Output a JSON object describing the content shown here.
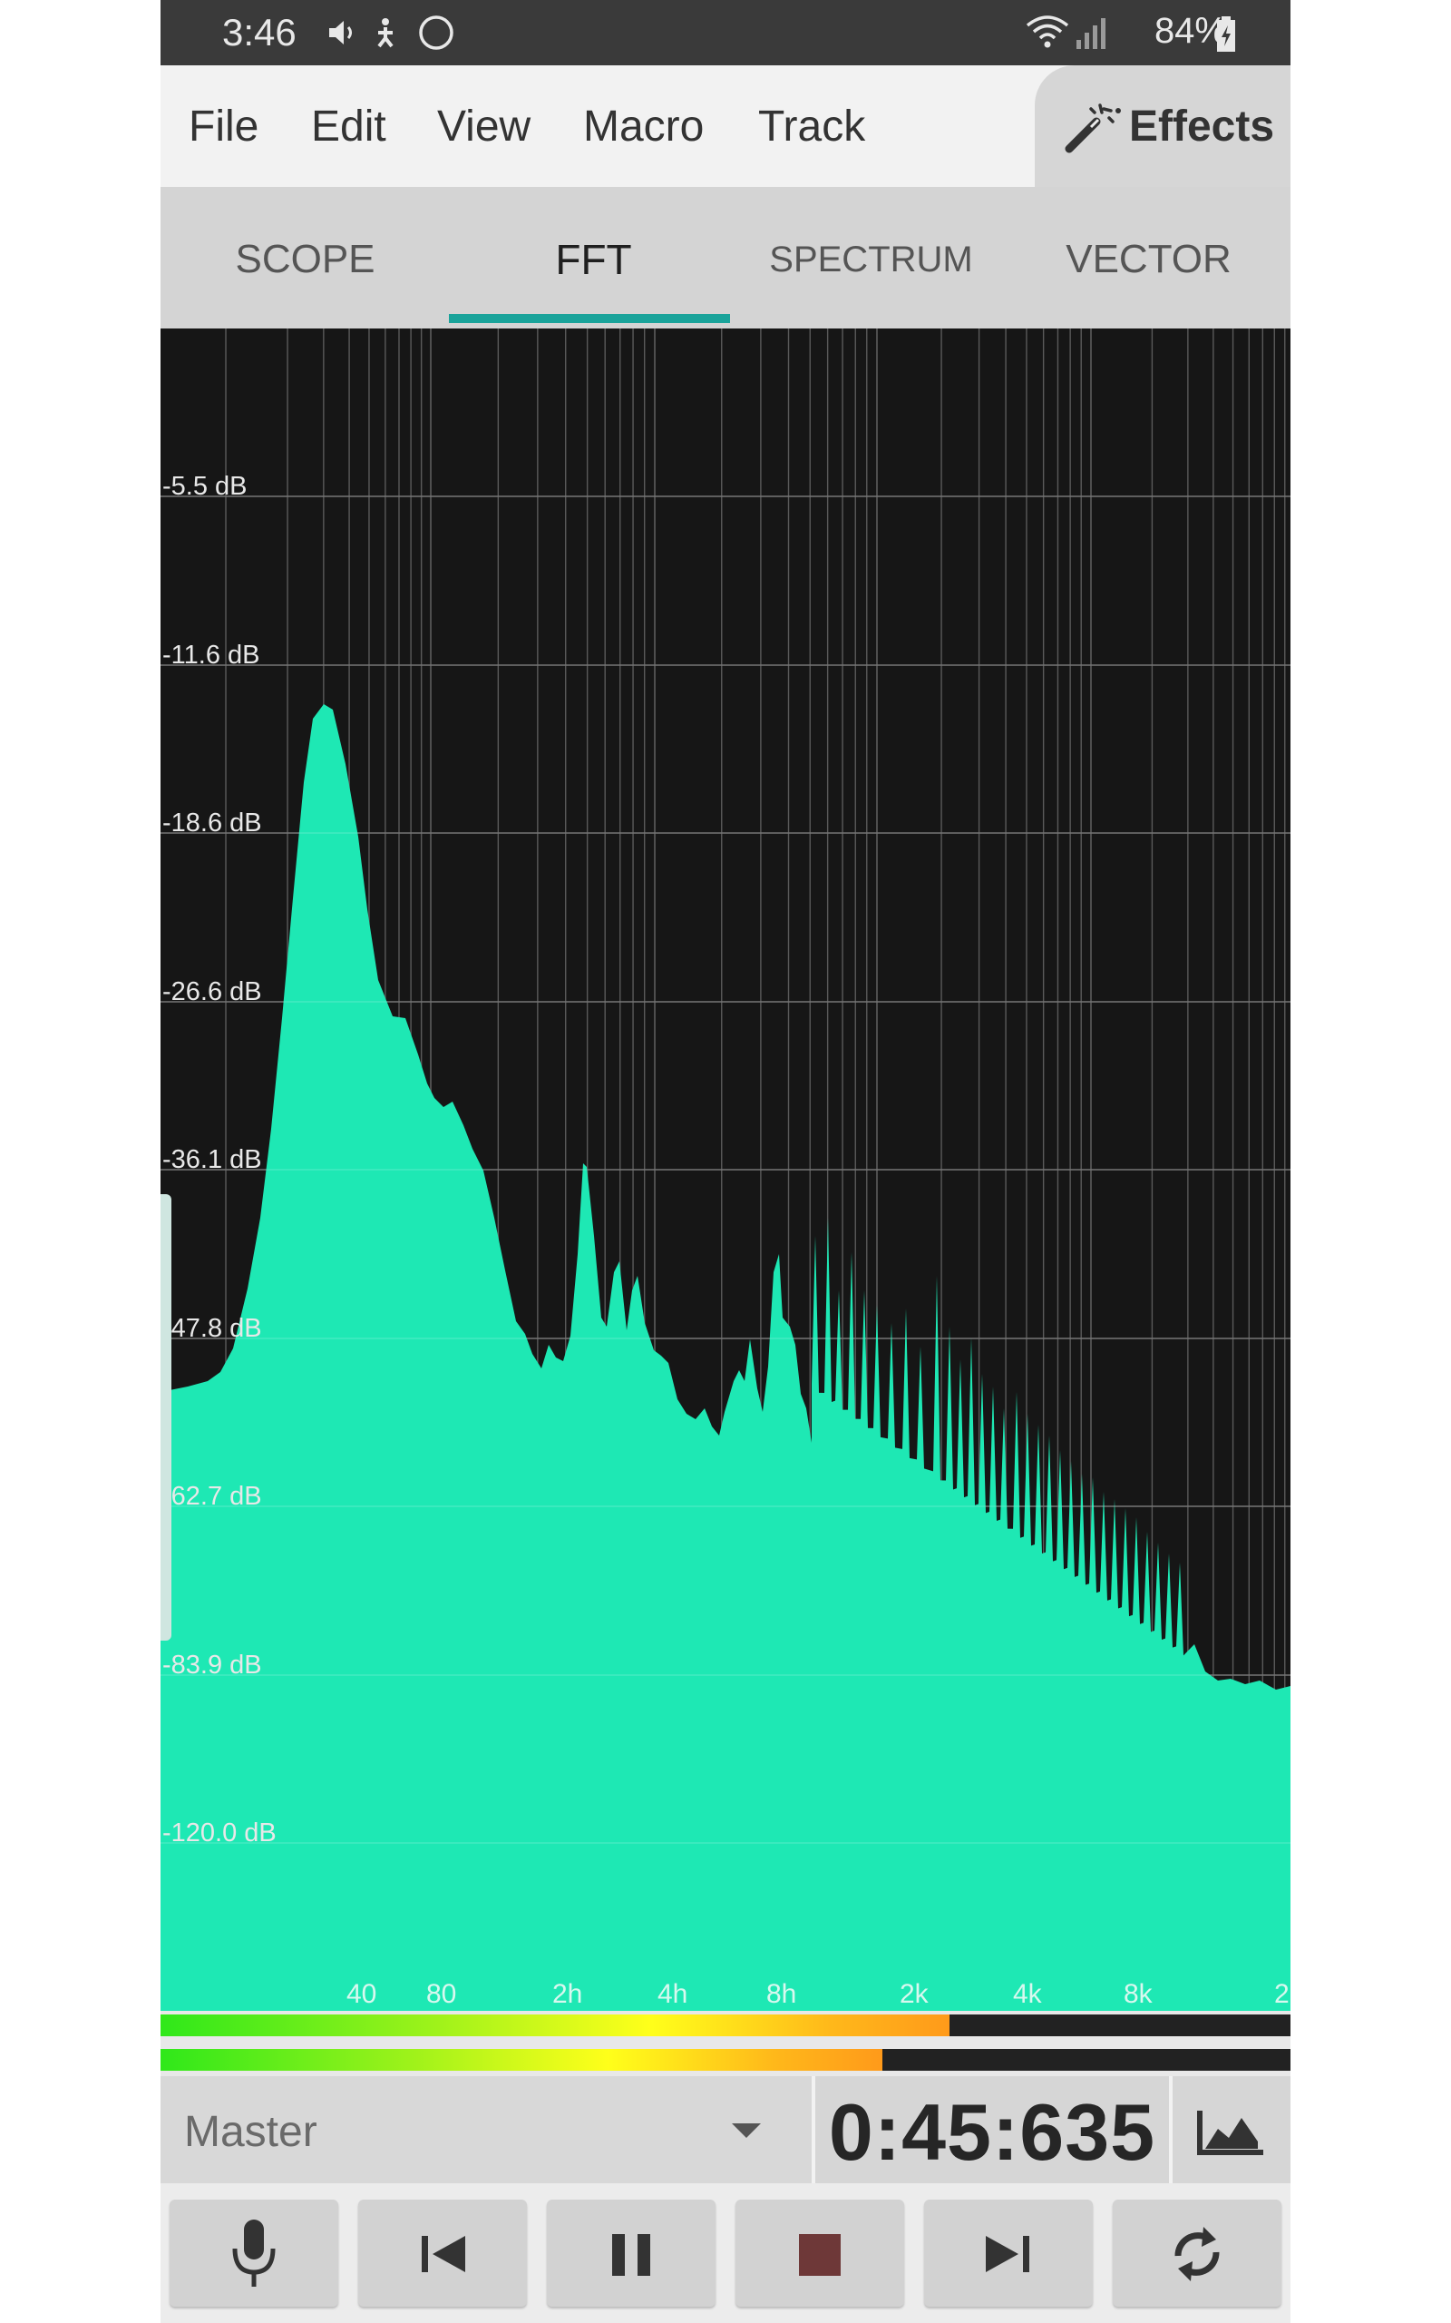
{
  "status_bar": {
    "time": "3:46",
    "battery": "84%",
    "icons": [
      "volume-icon",
      "accessibility-icon",
      "sync-icon",
      "wifi-icon",
      "signal-icon",
      "battery-icon"
    ]
  },
  "menu": {
    "items": [
      "File",
      "Edit",
      "View",
      "Macro",
      "Track"
    ],
    "effects_label": "Effects"
  },
  "tabs": {
    "items": [
      "SCOPE",
      "FFT",
      "SPECTRUM",
      "VECTOR"
    ],
    "active": "FFT"
  },
  "fft": {
    "db_labels": [
      "-5.5 dB",
      "-11.6 dB",
      "-18.6 dB",
      "-26.6 dB",
      "-36.1 dB",
      "-47.8 dB",
      "-62.7 dB",
      "-83.9 dB",
      "-120.0 dB"
    ],
    "freq_labels": [
      "40",
      "80",
      "2h",
      "4h",
      "8h",
      "2k",
      "4k",
      "8k",
      "2"
    ],
    "fill_color": "#1ee8b4",
    "background_color": "#161616"
  },
  "meters": {
    "left_level": 0.698,
    "right_level": 0.639
  },
  "info_bar": {
    "track_name": "Master",
    "time_position": "0:45:635"
  },
  "transport": {
    "buttons": [
      "microphone-icon",
      "skip-back-icon",
      "pause-icon",
      "stop-icon",
      "skip-forward-icon",
      "loop-icon"
    ]
  },
  "colors": {
    "accent": "#1aa39a",
    "status_bar_bg": "#3a3a3a"
  }
}
